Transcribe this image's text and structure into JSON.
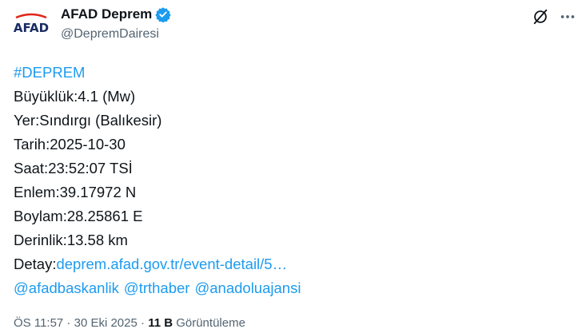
{
  "account": {
    "avatar_text": "AFAD",
    "display_name": "AFAD Deprem",
    "handle": "@DepremDairesi",
    "verified": true
  },
  "icons": {
    "verified": "verified-badge-icon",
    "grok": "grok-icon",
    "more": "more-horizontal-icon"
  },
  "colors": {
    "link": "#1d9bf0",
    "text": "#0f1419",
    "muted": "#536471",
    "brand_navy": "#1a2c63",
    "brand_red": "#e2231a"
  },
  "tweet": {
    "hashtag": "#DEPREM",
    "lines": [
      "Büyüklük:4.1 (Mw)",
      "Yer:Sındırgı (Balıkesir)",
      "Tarih:2025-10-30",
      "Saat:23:52:07 TSİ",
      "Enlem:39.17972 N",
      "Boylam:28.25861 E",
      "Derinlik:13.58 km"
    ],
    "detail_label": "Detay:",
    "detail_link": "deprem.afad.gov.tr/event-detail/5…",
    "mentions": [
      "@afadbaskanlik",
      "@trthaber",
      "@anadoluajansi"
    ]
  },
  "meta": {
    "time": "ÖS 11:57",
    "sep1": " · ",
    "date": "30 Eki 2025",
    "sep2": " · ",
    "views_count": "11 B",
    "views_label": " Görüntüleme"
  }
}
